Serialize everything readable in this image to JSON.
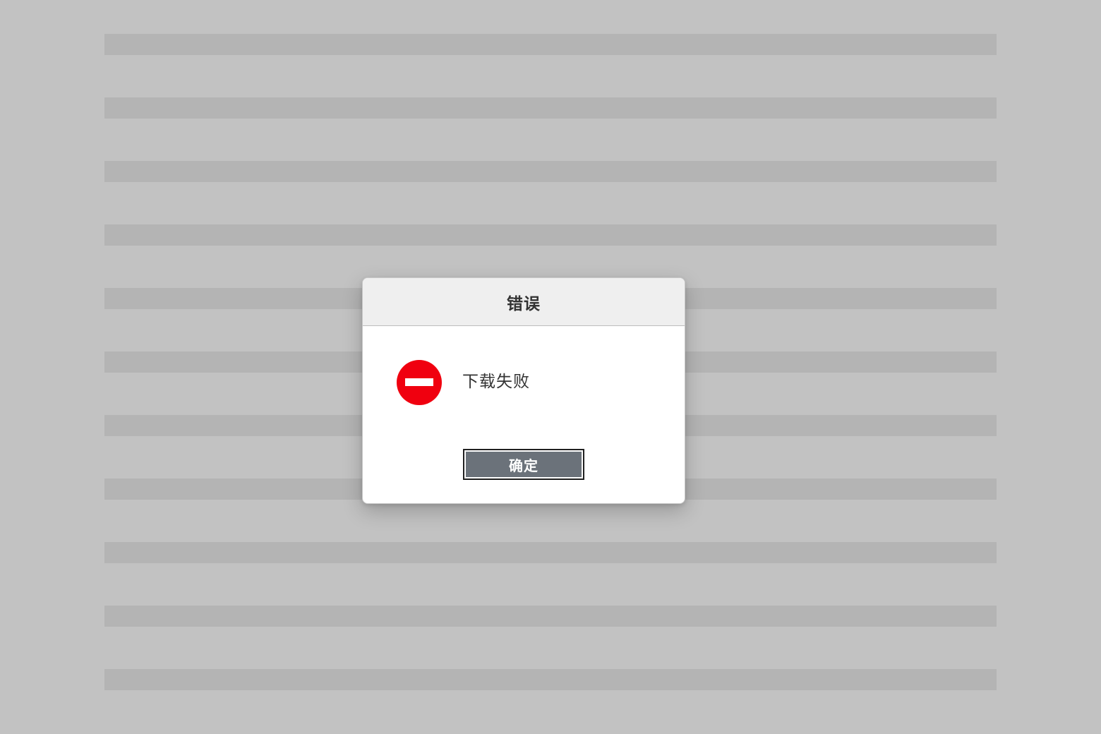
{
  "dialog": {
    "title": "错误",
    "message": "下载失败",
    "icon": "error-stop-icon",
    "ok_label": "确定"
  },
  "colors": {
    "backdrop": "#c2c2c2",
    "placeholder_line": "#b4b4b4",
    "error_red": "#f0000f",
    "button_fill": "#6b727a"
  }
}
